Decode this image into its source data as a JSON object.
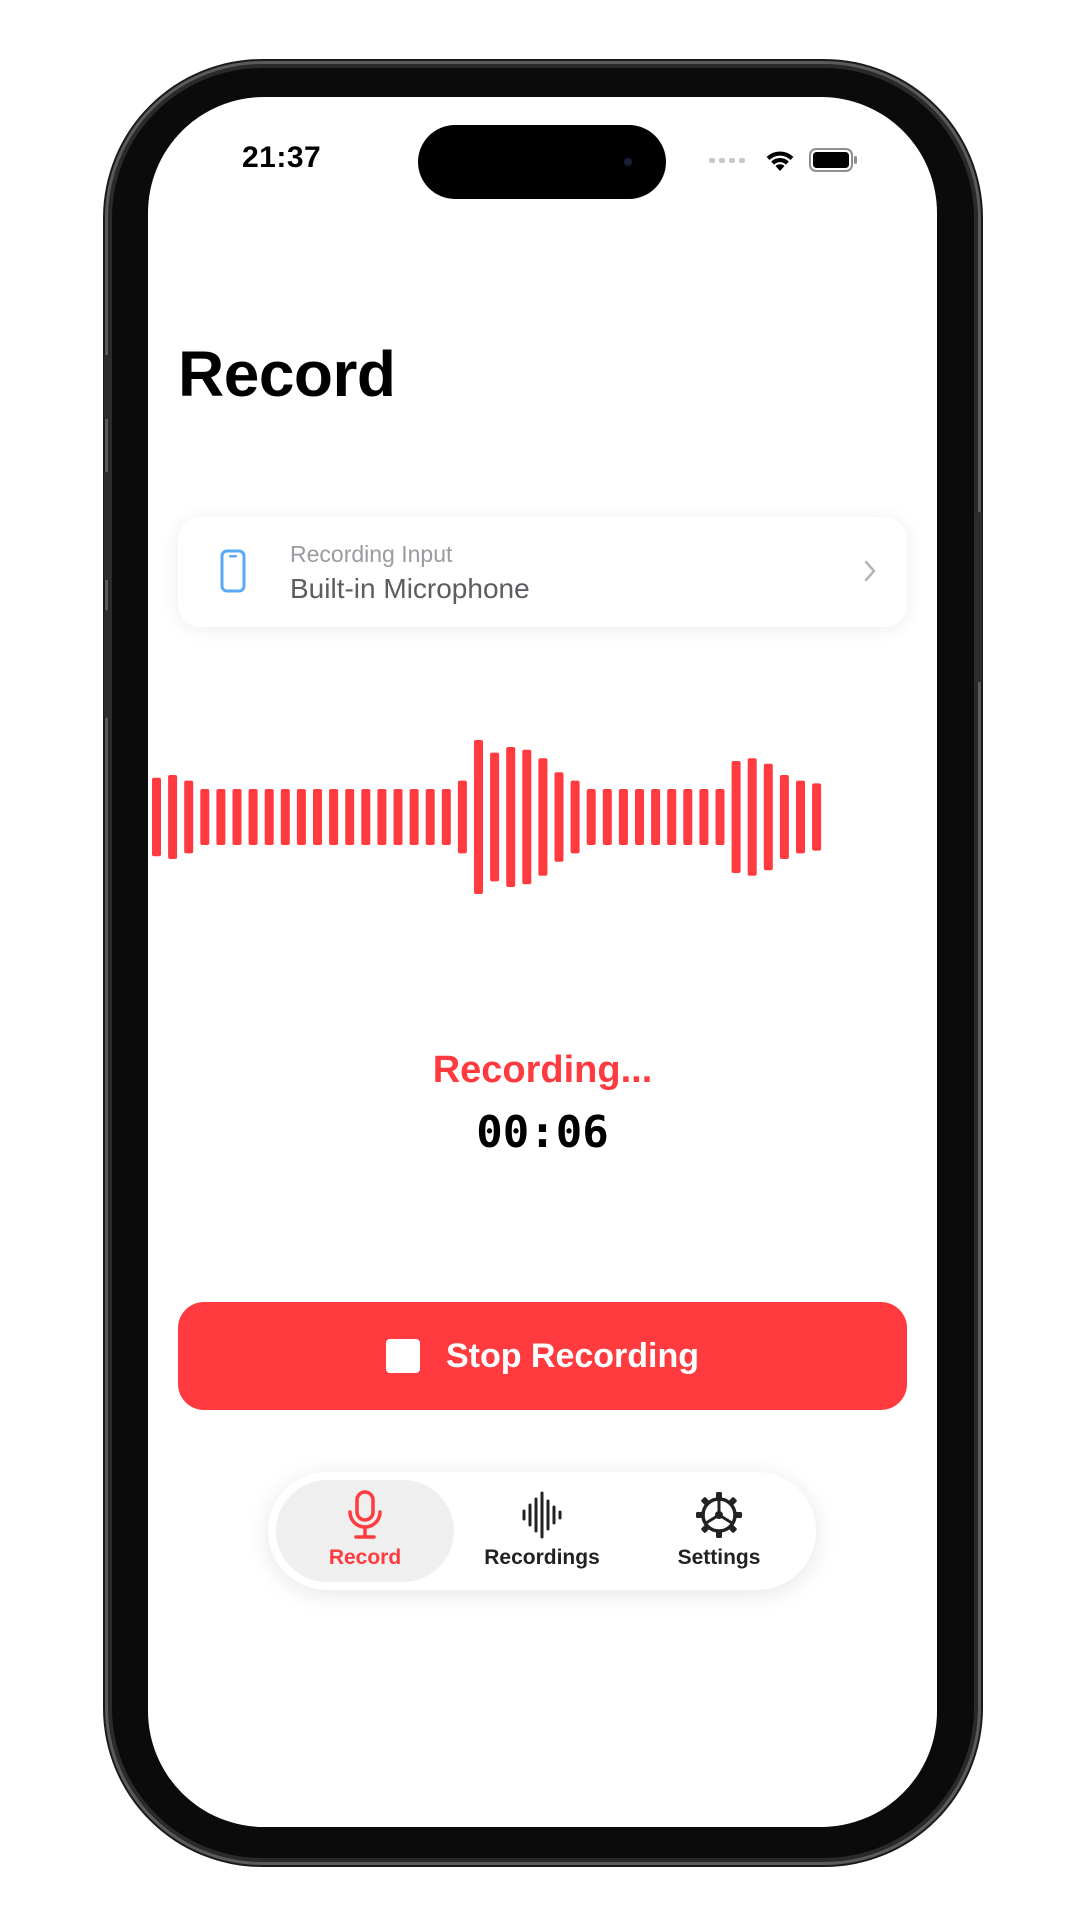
{
  "status_bar": {
    "time": "21:37",
    "signal_icon": "cellular-dots-icon",
    "wifi_icon": "wifi-icon",
    "battery_icon": "battery-full-icon"
  },
  "header": {
    "title": "Record"
  },
  "recording_input": {
    "caption": "Recording Input",
    "value": "Built-in Microphone",
    "icon": "iphone-icon"
  },
  "waveform": {
    "color": "#ff3b3f",
    "levels": [
      0.28,
      0.3,
      0.26,
      0.2,
      0.2,
      0.2,
      0.2,
      0.2,
      0.2,
      0.2,
      0.2,
      0.2,
      0.2,
      0.2,
      0.2,
      0.2,
      0.2,
      0.2,
      0.2,
      0.26,
      0.55,
      0.46,
      0.5,
      0.48,
      0.42,
      0.32,
      0.26,
      0.2,
      0.2,
      0.2,
      0.2,
      0.2,
      0.2,
      0.2,
      0.2,
      0.2,
      0.4,
      0.42,
      0.38,
      0.3,
      0.26,
      0.24
    ]
  },
  "recorder": {
    "status": "Recording...",
    "elapsed": "00:06"
  },
  "stop_button": {
    "label": "Stop Recording",
    "icon": "stop-square-icon"
  },
  "tab_bar": {
    "tabs": [
      {
        "label": "Record",
        "icon": "microphone-icon",
        "active": true
      },
      {
        "label": "Recordings",
        "icon": "waveform-icon",
        "active": false
      },
      {
        "label": "Settings",
        "icon": "gear-icon",
        "active": false
      }
    ]
  },
  "colors": {
    "accent": "#ff3b3f",
    "input_icon": "#5aa9f5"
  }
}
